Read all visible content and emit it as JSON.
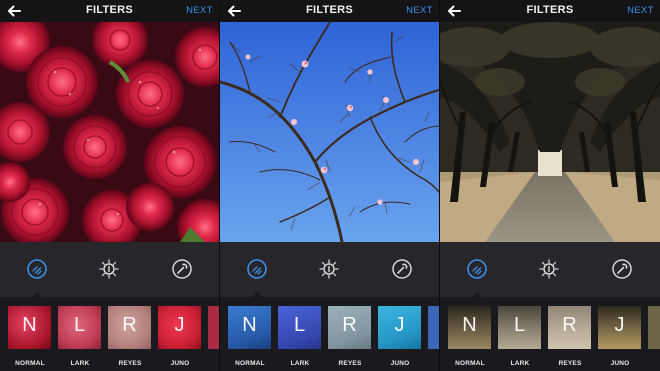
{
  "header": {
    "title": "FILTERS",
    "next_label": "NEXT"
  },
  "icons": {
    "back": "arrow-left-icon",
    "filter": "filter-icon",
    "lux": "lux-brightness-icon",
    "edit": "wrench-edit-icon"
  },
  "colors": {
    "accent": "#3d8ee8",
    "topbar": "#141417",
    "panel": "#26262b",
    "strip": "#1a1a1e"
  },
  "panels": [
    {
      "photo": "red-peonies",
      "filters": [
        {
          "letter": "N",
          "label": "NORMAL",
          "color": "#c8283d"
        },
        {
          "letter": "L",
          "label": "LARK",
          "color": "#c44055"
        },
        {
          "letter": "R",
          "label": "REYES",
          "color": "#b78b87"
        },
        {
          "letter": "J",
          "label": "JUNO",
          "color": "#c81f33"
        }
      ]
    },
    {
      "photo": "magnolia-branches-sky",
      "filters": [
        {
          "letter": "N",
          "label": "NORMAL",
          "color": "#2f6fbd"
        },
        {
          "letter": "L",
          "label": "LARK",
          "color": "#3a58c7"
        },
        {
          "letter": "R",
          "label": "REYES",
          "color": "#8aa0aa"
        },
        {
          "letter": "J",
          "label": "JUNO",
          "color": "#2fa6d3"
        }
      ]
    },
    {
      "photo": "cypress-tree-tunnel",
      "filters": [
        {
          "letter": "N",
          "label": "NORMAL",
          "color": "#6b5d43"
        },
        {
          "letter": "L",
          "label": "LARK",
          "color": "#8a8270"
        },
        {
          "letter": "R",
          "label": "REYES",
          "color": "#b8ab98"
        },
        {
          "letter": "J",
          "label": "JUNO",
          "color": "#7a6a47"
        }
      ]
    }
  ]
}
